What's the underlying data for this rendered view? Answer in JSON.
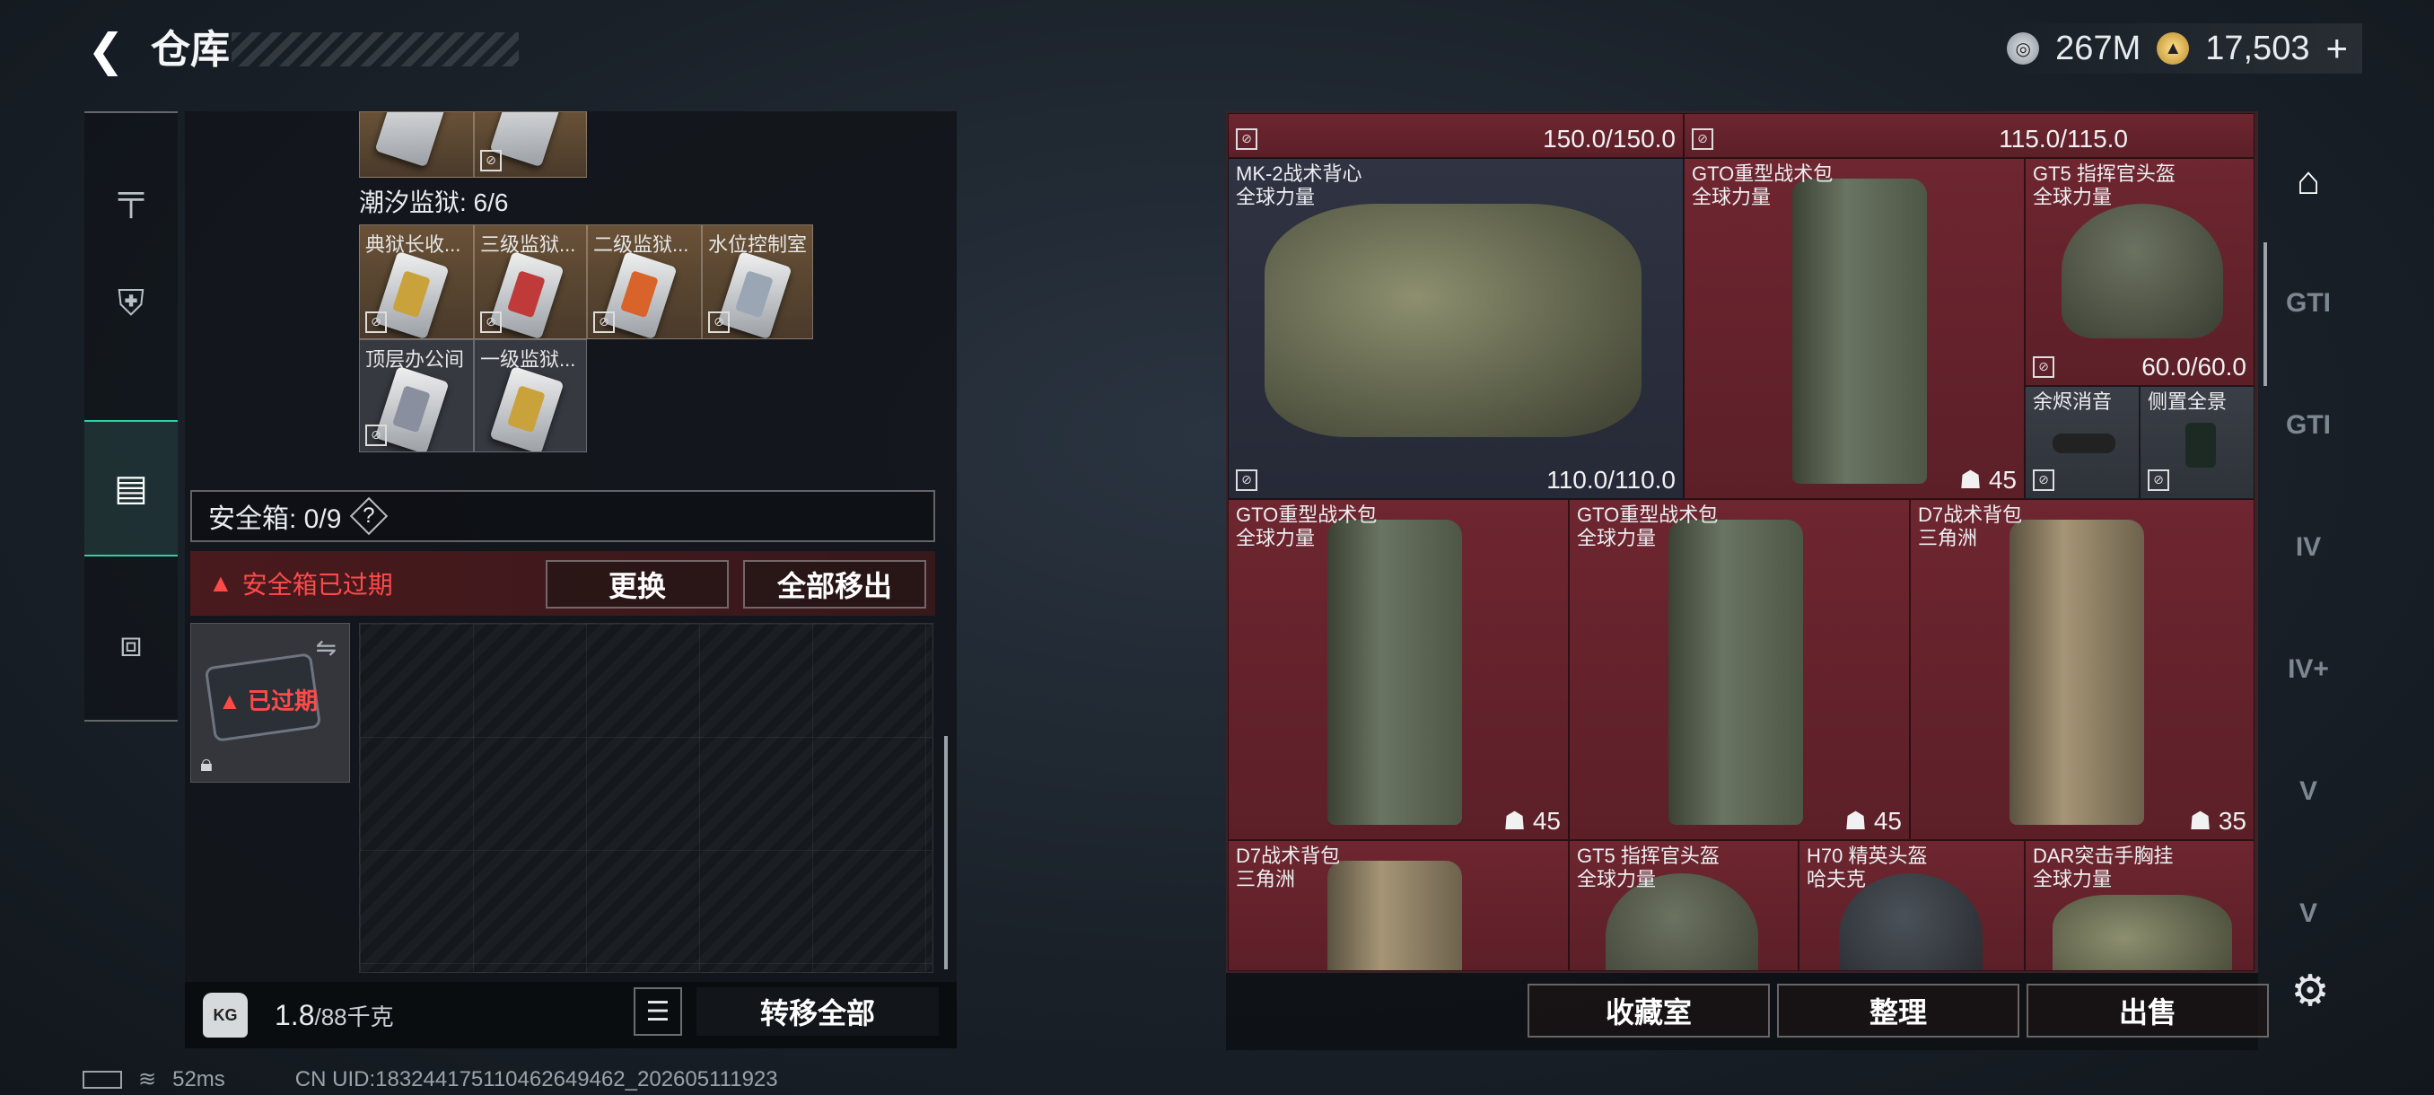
{
  "header": {
    "back_icon": "chevron-left-icon",
    "title": "仓库"
  },
  "currency": {
    "silver": "267M",
    "gold": "17,503",
    "gold_add": "+"
  },
  "left_nav": [
    "gun-icon",
    "armor-icon",
    "backpack-icon",
    "toolbox-icon"
  ],
  "inventory": {
    "prison_label": "潮汐监狱: 6/6",
    "keys_row1": [
      "典狱长收...",
      "三级监狱...",
      "二级监狱...",
      "水位控制室"
    ],
    "keys_row2": [
      "顶层办公间",
      "一级监狱..."
    ],
    "no_insure_icon": "⊘"
  },
  "safe_box": {
    "label": "安全箱: 0/9",
    "help": "?",
    "expired_notice": "安全箱已过期",
    "replace_label": "更换",
    "remove_all_label": "全部移出",
    "expired_tag": "已过期"
  },
  "footer_left": {
    "weight": "1.8",
    "weight_cap": "/88千克",
    "transfer_all": "转移全部"
  },
  "status": {
    "ping": "52ms",
    "uid": "CN UID:1832441751104626494​62_202605111923"
  },
  "items": {
    "top_dura_1": "150.0/150.0",
    "top_dura_2": "115.0/115.0",
    "vest": {
      "name": "MK-2战术背心",
      "faction": "全球力量",
      "dura": "110.0/110.0"
    },
    "bag1": {
      "name": "GTO重型战术包",
      "faction": "全球力量",
      "cap": "45"
    },
    "helmet1": {
      "name": "GT5 指挥官头盔",
      "faction": "全球力量",
      "dura": "60.0/60.0"
    },
    "muzzle": {
      "name": "余烬消音"
    },
    "scope": {
      "name": "侧置全景"
    },
    "bag2": {
      "name": "GTO重型战术包",
      "faction": "全球力量",
      "cap": "45"
    },
    "bag3": {
      "name": "GTO重型战术包",
      "faction": "全球力量",
      "cap": "45"
    },
    "bag4": {
      "name": "D7战术背包",
      "faction": "三角洲",
      "cap": "35"
    },
    "bag5": {
      "name": "D7战术背包",
      "faction": "三角洲"
    },
    "helmet2": {
      "name": "GT5 指挥官头盔",
      "faction": "全球力量"
    },
    "helmet3": {
      "name": "H70 精英头盔",
      "faction": "哈夫克"
    },
    "rig": {
      "name": "DAR突击手胸挂",
      "faction": "全球力量"
    }
  },
  "right_footer": {
    "collection": "收藏室",
    "sort": "整理",
    "sell": "出售"
  },
  "right_nav": [
    "GTI",
    "GTI",
    "IV",
    "IV+",
    "V",
    "V"
  ]
}
